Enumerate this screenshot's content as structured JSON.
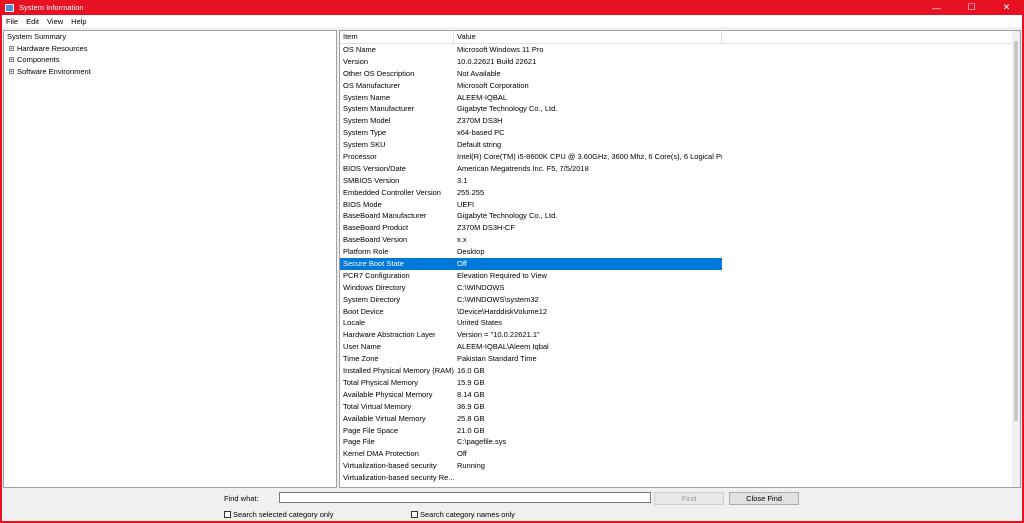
{
  "window": {
    "title": "System Information",
    "minimize_glyph": "—",
    "maximize_glyph": "☐",
    "close_glyph": "✕"
  },
  "menu": [
    "File",
    "Edit",
    "View",
    "Help"
  ],
  "tree": {
    "root": "System Summary",
    "children": [
      "Hardware Resources",
      "Components",
      "Software Environment"
    ],
    "expand_glyph": "+"
  },
  "table": {
    "headers": {
      "item": "Item",
      "value": "Value"
    },
    "rows": [
      {
        "item": "OS Name",
        "value": "Microsoft Windows 11 Pro"
      },
      {
        "item": "Version",
        "value": "10.0.22621 Build 22621"
      },
      {
        "item": "Other OS Description",
        "value": "Not Available"
      },
      {
        "item": "OS Manufacturer",
        "value": "Microsoft Corporation"
      },
      {
        "item": "System Name",
        "value": "ALEEM-IQBAL"
      },
      {
        "item": "System Manufacturer",
        "value": "Gigabyte Technology Co., Ltd."
      },
      {
        "item": "System Model",
        "value": "Z370M DS3H"
      },
      {
        "item": "System Type",
        "value": "x64-based PC"
      },
      {
        "item": "System SKU",
        "value": "Default string"
      },
      {
        "item": "Processor",
        "value": "Intel(R) Core(TM) i5-8600K CPU @ 3.60GHz, 3600 Mhz, 6 Core(s), 6 Logical Pr..."
      },
      {
        "item": "BIOS Version/Date",
        "value": "American Megatrends Inc. F5, 7/5/2018"
      },
      {
        "item": "SMBIOS Version",
        "value": "3.1"
      },
      {
        "item": "Embedded Controller Version",
        "value": "255.255"
      },
      {
        "item": "BIOS Mode",
        "value": "UEFI"
      },
      {
        "item": "BaseBoard Manufacturer",
        "value": "Gigabyte Technology Co., Ltd."
      },
      {
        "item": "BaseBoard Product",
        "value": "Z370M DS3H-CF"
      },
      {
        "item": "BaseBoard Version",
        "value": "x.x"
      },
      {
        "item": "Platform Role",
        "value": "Desktop"
      },
      {
        "item": "Secure Boot State",
        "value": "Off"
      },
      {
        "item": "PCR7 Configuration",
        "value": "Elevation Required to View"
      },
      {
        "item": "Windows Directory",
        "value": "C:\\WINDOWS"
      },
      {
        "item": "System Directory",
        "value": "C:\\WINDOWS\\system32"
      },
      {
        "item": "Boot Device",
        "value": "\\Device\\HarddiskVolume12"
      },
      {
        "item": "Locale",
        "value": "United States"
      },
      {
        "item": "Hardware Abstraction Layer",
        "value": "Version = \"10.0.22621.1\""
      },
      {
        "item": "User Name",
        "value": "ALEEM-IQBAL\\Aleem Iqbal"
      },
      {
        "item": "Time Zone",
        "value": "Pakistan Standard Time"
      },
      {
        "item": "Installed Physical Memory (RAM)",
        "value": "16.0 GB"
      },
      {
        "item": "Total Physical Memory",
        "value": "15.9 GB"
      },
      {
        "item": "Available Physical Memory",
        "value": "8.14 GB"
      },
      {
        "item": "Total Virtual Memory",
        "value": "36.9 GB"
      },
      {
        "item": "Available Virtual Memory",
        "value": "25.8 GB"
      },
      {
        "item": "Page File Space",
        "value": "21.0 GB"
      },
      {
        "item": "Page File",
        "value": "C:\\pagefile.sys"
      },
      {
        "item": "Kernel DMA Protection",
        "value": "Off"
      },
      {
        "item": "Virtualization-based security",
        "value": "Running"
      },
      {
        "item": "Virtualization-based security Re...",
        "value": ""
      }
    ],
    "selected_row": 18
  },
  "find": {
    "label": "Find what:",
    "input_value": "",
    "find_button": "Find",
    "close_find_button": "Close Find",
    "search_selected_label": "Search selected category only",
    "search_names_label": "Search category names only"
  },
  "colors": {
    "titlebar": "#e81123",
    "selection": "#0078d7"
  }
}
